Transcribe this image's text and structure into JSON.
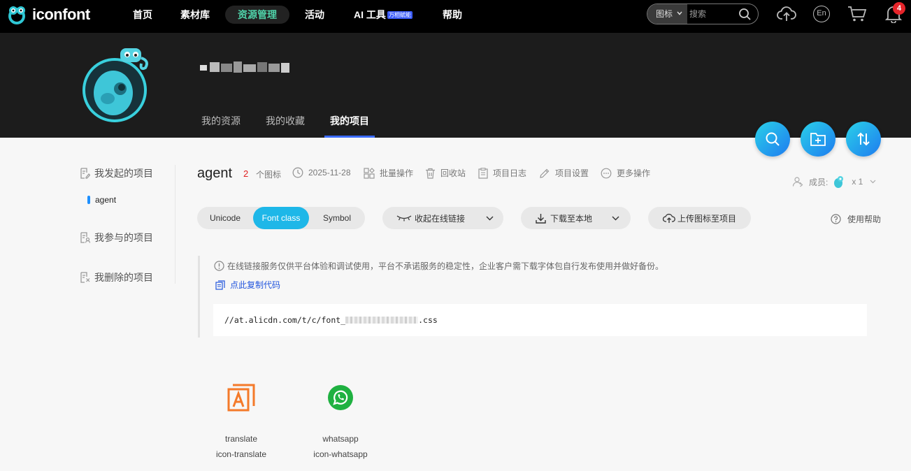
{
  "nav": {
    "logo": "iconfont",
    "items": [
      {
        "label": "首页"
      },
      {
        "label": "素材库"
      },
      {
        "label": "资源管理"
      },
      {
        "label": "活动"
      },
      {
        "label": "AI 工具",
        "badge": "万相赋能"
      },
      {
        "label": "帮助"
      }
    ],
    "search_type": "图标",
    "search_placeholder": "搜索",
    "lang": "En",
    "notifications": "4",
    "accent": "#4fd1a8"
  },
  "profile": {
    "tabs": [
      {
        "label": "我的资源"
      },
      {
        "label": "我的收藏"
      },
      {
        "label": "我的项目"
      }
    ]
  },
  "sidebar": {
    "items": [
      {
        "label": "我发起的项目"
      },
      {
        "label": "我参与的项目"
      },
      {
        "label": "我删除的项目"
      }
    ],
    "sub_item": "agent"
  },
  "project": {
    "name": "agent",
    "icon_count": "2",
    "icon_count_label": "个图标",
    "date": "2025-11-28",
    "actions": [
      {
        "label": "批量操作"
      },
      {
        "label": "回收站"
      },
      {
        "label": "项目日志"
      },
      {
        "label": "项目设置"
      },
      {
        "label": "更多操作"
      }
    ],
    "members_label": "成员:",
    "members_count": "x 1"
  },
  "toolbar": {
    "modes": [
      {
        "label": "Unicode"
      },
      {
        "label": "Font class"
      },
      {
        "label": "Symbol"
      }
    ],
    "collapse_link": "收起在线链接",
    "download": "下载至本地",
    "upload": "上传图标至项目",
    "help": "使用帮助",
    "active_color": "#1eb7e8"
  },
  "code": {
    "notice": "在线链接服务仅供平台体验和调试使用，平台不承诺服务的稳定性，企业客户需下载字体包自行发布使用并做好备份。",
    "copy_label": "点此复制代码",
    "url_prefix": "//at.alicdn.com/t/c/font_",
    "url_suffix": ".css"
  },
  "icons": [
    {
      "name": "translate",
      "class": "icon-translate",
      "color": "#f47a2a"
    },
    {
      "name": "whatsapp",
      "class": "icon-whatsapp",
      "color": "#1fb141"
    }
  ]
}
